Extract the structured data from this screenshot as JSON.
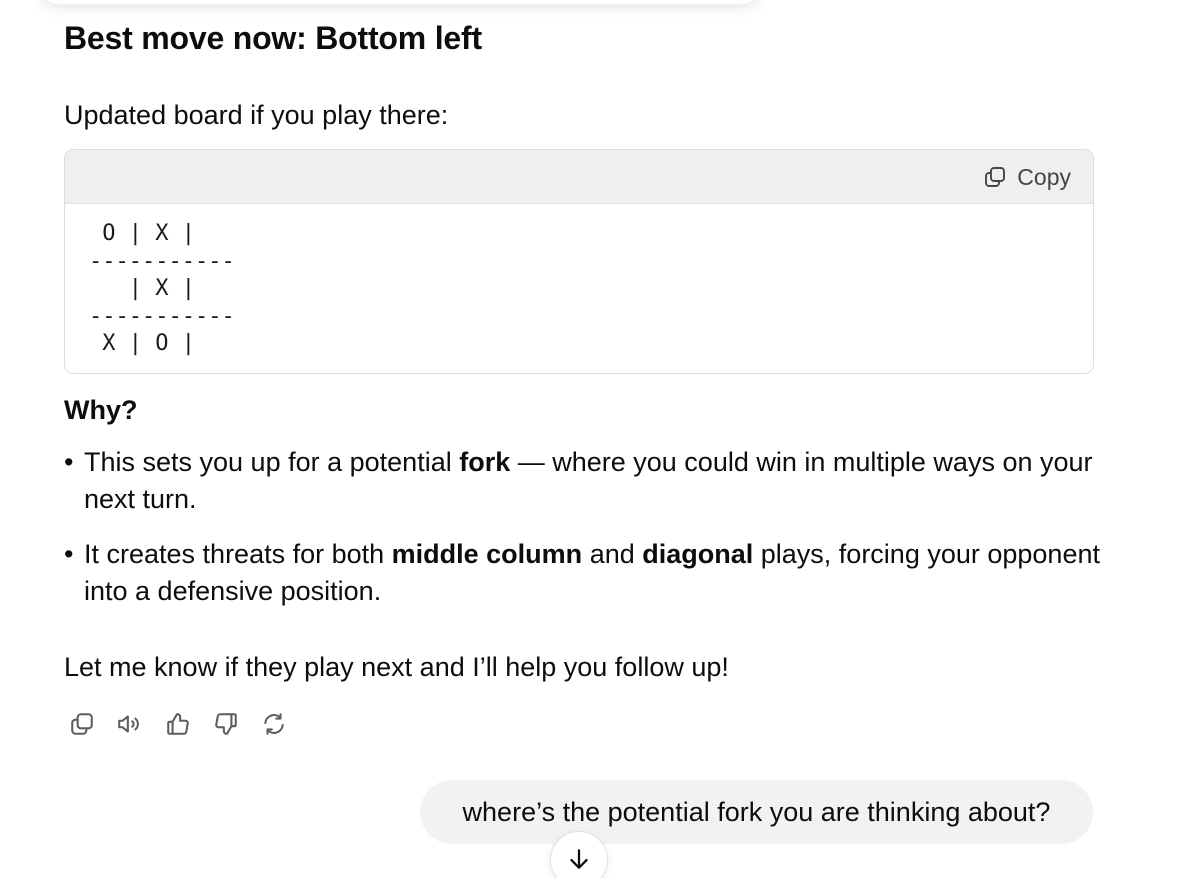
{
  "response": {
    "heading": "Best move now: Bottom left",
    "intro": "Updated board if you play there:",
    "code_block": {
      "copy_label": "Copy",
      "copy_icon": "copy-icon",
      "lines": [
        " O | X |",
        "-----------",
        "   | X |",
        "-----------",
        " X | O |"
      ]
    },
    "why_heading": "Why?",
    "bullets": [
      {
        "before": "This sets you up for a potential ",
        "bold1": "fork",
        "middle": " — where you could win in multiple ways on your next turn.",
        "bold2": "",
        "after": ""
      },
      {
        "before": "It creates threats for both ",
        "bold1": "middle column",
        "middle": " and ",
        "bold2": "diagonal",
        "after": " plays, forcing your opponent into a defensive position."
      }
    ],
    "closing": "Let me know if they play next and I’ll help you follow up!",
    "actions": [
      "copy-icon",
      "read-aloud-icon",
      "thumbs-up-icon",
      "thumbs-down-icon",
      "regenerate-icon"
    ]
  },
  "user_message": {
    "text": "where’s the potential fork you are thinking about?"
  },
  "scroll_button": {
    "icon": "arrow-down-icon"
  }
}
